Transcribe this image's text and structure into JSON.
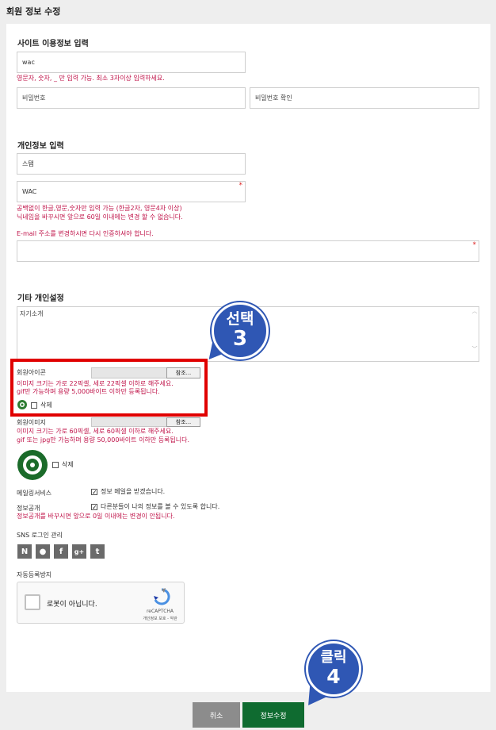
{
  "page": {
    "title": "회원 정보 수정"
  },
  "site": {
    "title": "사이트 이용정보 입력",
    "id_value": "wac",
    "id_help": "영문자, 숫자, _ 만 입력 가능. 최소 3자이상 입력하세요.",
    "password_placeholder": "비밀번호",
    "password_confirm_placeholder": "비밀번호 확인"
  },
  "personal": {
    "title": "개인정보 입력",
    "name_value": "스탬",
    "nick_value": "WAC",
    "nick_help_1": "공백없이 한글,영문,숫자만 입력 가능 (한글2자, 영문4자 이상)",
    "nick_help_2": "닉네임을 바꾸시면 앞으로 60일 이내에는 변경 할 수 없습니다.",
    "email_help": "E-mail 주소를 변경하시면 다시 인증하셔야 합니다.",
    "required_mark": "*"
  },
  "etc": {
    "title": "기타 개인설정",
    "intro_placeholder": "자기소개",
    "icon_label": "회원아이콘",
    "browse_label": "참조...",
    "icon_help_1": "이미지 크기는 가로 22픽셀, 세로 22픽셀 이하로 해주세요.",
    "icon_help_2": "gif만 가능하며 용량 5,000바이트 이하만 등록됩니다.",
    "delete_label": "삭제",
    "image_label": "회원이미지",
    "image_help_1": "이미지 크기는 가로 60픽셀, 세로 60픽셀 이하로 해주세요.",
    "image_help_2": "gif 또는 jpg만 가능하며 용량 50,000바이트 이하만 등록됩니다.",
    "mailing_label": "메일링서비스",
    "mailing_text": "정보 메일을 받겠습니다.",
    "open_label": "정보공개",
    "open_text": "다른분들이 나의 정보를 볼 수 있도록 합니다.",
    "open_help": "정보공개를 바꾸시면 앞으로 0일 이내에는 변경이 안됩니다.",
    "sns_label": "SNS 로그인 관리",
    "sns": [
      {
        "icon": "naver-icon",
        "glyph": "N"
      },
      {
        "icon": "kakao-icon",
        "glyph": "●"
      },
      {
        "icon": "facebook-icon",
        "glyph": "f"
      },
      {
        "icon": "googleplus-icon",
        "glyph": "g+"
      },
      {
        "icon": "twitter-icon",
        "glyph": "t"
      }
    ],
    "captcha_label": "자동등록방지",
    "captcha_text": "로봇이 아닙니다.",
    "captcha_brand": "reCAPTCHA",
    "captcha_links": "개인정보 보호 - 약관"
  },
  "annotations": {
    "select_text": "선택",
    "select_num": "3",
    "click_text": "클릭",
    "click_num": "4"
  },
  "buttons": {
    "cancel": "취소",
    "submit": "정보수정"
  },
  "colors": {
    "submit_bg": "#0f6b30",
    "cancel_bg": "#8c8c8c",
    "help_text": "#c0144a",
    "badge": "#2f57b4",
    "highlight": "#e00000"
  }
}
